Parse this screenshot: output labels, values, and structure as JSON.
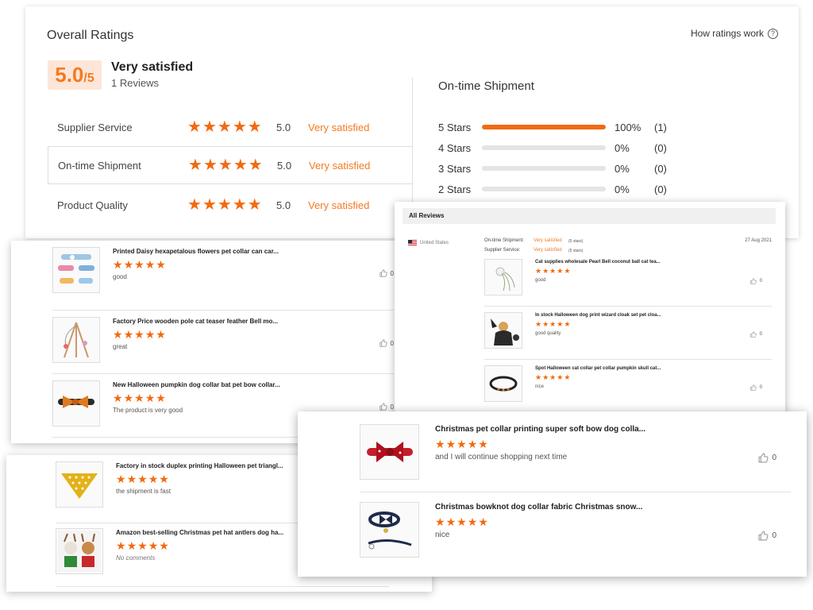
{
  "overall": {
    "title": "Overall Ratings",
    "how_link": "How ratings work",
    "score_value": "5.0",
    "score_max": "/5",
    "verdict": "Very satisfied",
    "review_count": "1 Reviews",
    "categories": [
      {
        "label": "Supplier Service",
        "score": "5.0",
        "verdict": "Very satisfied",
        "stars": 5
      },
      {
        "label": "On-time Shipment",
        "score": "5.0",
        "verdict": "Very satisfied",
        "stars": 5
      },
      {
        "label": "Product Quality",
        "score": "5.0",
        "verdict": "Very satisfied",
        "stars": 5
      }
    ]
  },
  "shipment": {
    "title": "On-time Shipment",
    "rows": [
      {
        "label": "5 Stars",
        "fill": 1.0,
        "pct": "100%",
        "count": "(1)"
      },
      {
        "label": "4 Stars",
        "fill": 0,
        "pct": "0%",
        "count": "(0)"
      },
      {
        "label": "3 Stars",
        "fill": 0,
        "pct": "0%",
        "count": "(0)"
      },
      {
        "label": "2 Stars",
        "fill": 0,
        "pct": "0%",
        "count": "(0)"
      }
    ]
  },
  "left_reviews": [
    {
      "title": "Printed Daisy hexapetalous flowers pet collar can car...",
      "stars": 5,
      "text": "good",
      "likes": "0"
    },
    {
      "title": "Factory Price wooden pole cat teaser feather Bell mo...",
      "stars": 5,
      "text": "great",
      "likes": "0"
    },
    {
      "title": "New Halloween pumpkin dog collar bat pet bow collar...",
      "stars": 5,
      "text": "The product is very good",
      "likes": "0"
    }
  ],
  "all_reviews": {
    "header": "All Reviews",
    "country": "United States",
    "date": "27 Aug 2021",
    "meta": [
      {
        "label": "On-time Shipment:",
        "verdict": "Very satisfied",
        "note": "(5 stars)"
      },
      {
        "label": "Supplier Service:",
        "verdict": "Very satisfied",
        "note": "(5 stars)"
      }
    ],
    "items": [
      {
        "title": "Cat supplies wholesale Pearl Bell coconut ball cat tea...",
        "stars": 5,
        "text": "good",
        "likes": "0"
      },
      {
        "title": "In stock Halloween dog print wizard cloak set pet cloa...",
        "stars": 5,
        "text": "good  quality",
        "likes": "0"
      },
      {
        "title": "Spot Halloween cat collar pet collar pumpkin skull cat...",
        "stars": 5,
        "text": "nice",
        "likes": "0"
      }
    ]
  },
  "lower_reviews": [
    {
      "title": "Factory in stock duplex printing Halloween pet triangl...",
      "stars": 5,
      "text": "the shipment is fast"
    },
    {
      "title": "Amazon best-selling Christmas pet hat antlers dog ha...",
      "stars": 5,
      "text": "No comments"
    }
  ],
  "xmas_reviews": [
    {
      "title": "Christmas pet collar printing super soft bow dog colla...",
      "stars": 5,
      "text": "and I will continue shopping next time",
      "likes": "0"
    },
    {
      "title": "Christmas bowknot dog collar fabric Christmas snow...",
      "stars": 5,
      "text": "nice",
      "likes": "0"
    }
  ],
  "colors": {
    "accent": "#f26a10",
    "verdict": "#f47a20",
    "score_bg": "#fde6d8"
  }
}
